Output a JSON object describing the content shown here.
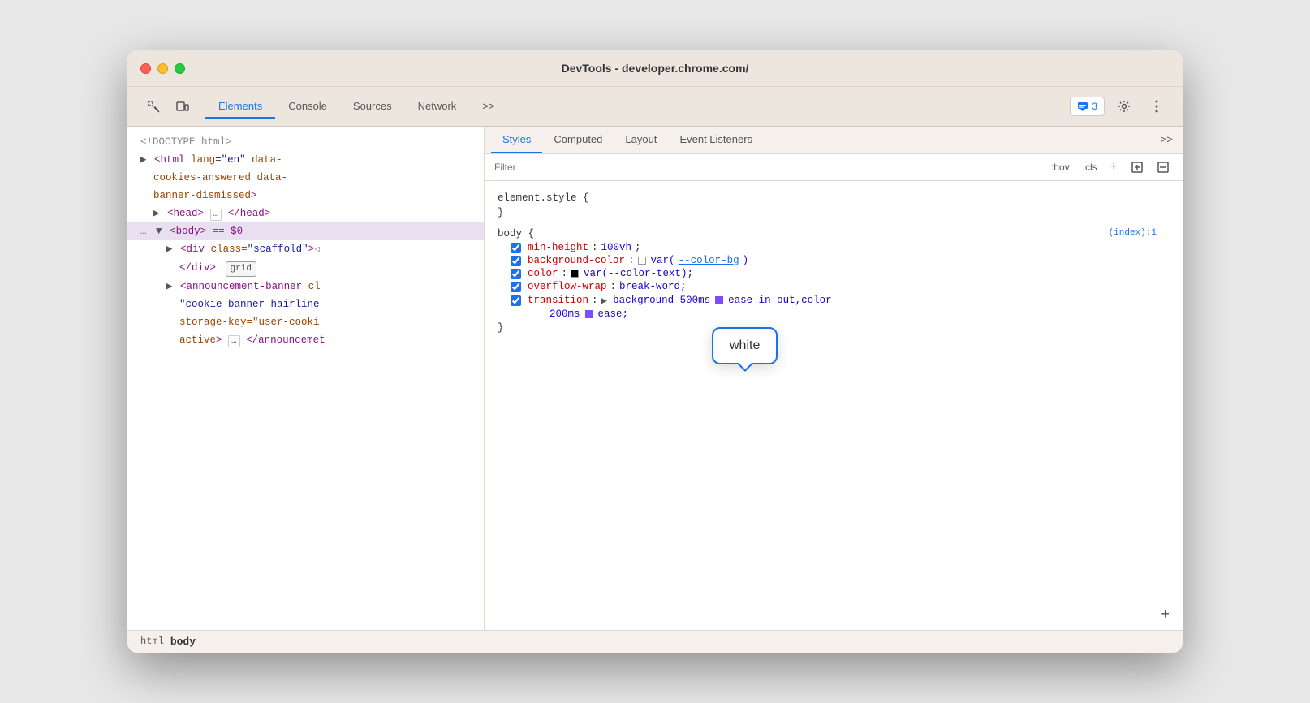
{
  "window": {
    "title": "DevTools - developer.chrome.com/"
  },
  "traffic_lights": {
    "red": "close",
    "yellow": "minimize",
    "green": "maximize"
  },
  "toolbar": {
    "tabs": [
      {
        "label": "Elements",
        "active": true
      },
      {
        "label": "Console",
        "active": false
      },
      {
        "label": "Sources",
        "active": false
      },
      {
        "label": "Network",
        "active": false
      },
      {
        "label": ">>",
        "active": false
      }
    ],
    "badge_label": "3",
    "more_label": ":"
  },
  "dom_panel": {
    "lines": [
      {
        "type": "comment",
        "text": "<!DOCTYPE html>",
        "indent": 0
      },
      {
        "type": "tag_open",
        "indent": 0
      },
      {
        "type": "body_selected",
        "indent": 0
      },
      {
        "type": "div_scaffold",
        "indent": 1
      },
      {
        "type": "div_close",
        "indent": 1
      },
      {
        "type": "announcement",
        "indent": 1
      },
      {
        "type": "announcement2",
        "indent": 1
      },
      {
        "type": "announcement3",
        "indent": 1
      }
    ]
  },
  "breadcrumb": {
    "items": [
      "html",
      "body"
    ]
  },
  "styles_panel": {
    "tabs": [
      {
        "label": "Styles",
        "active": true
      },
      {
        "label": "Computed",
        "active": false
      },
      {
        "label": "Layout",
        "active": false
      },
      {
        "label": "Event Listeners",
        "active": false
      },
      {
        "label": ">>",
        "active": false
      }
    ],
    "filter": {
      "placeholder": "Filter",
      "hov_label": ":hov",
      "cls_label": ".cls",
      "plus_label": "+"
    },
    "blocks": [
      {
        "selector": "element.style {",
        "close": "}",
        "rules": []
      },
      {
        "selector": "body {",
        "source": "(index):1",
        "close": "}",
        "rules": [
          {
            "prop": "min-height",
            "value": "100vh",
            "checked": true,
            "swatch": null
          },
          {
            "prop": "background-color",
            "value": "var(--color-bg)",
            "checked": true,
            "swatch": "white",
            "has_swatch": true
          },
          {
            "prop": "color",
            "value": "var(--color-text);",
            "checked": true,
            "swatch": "black",
            "has_swatch": true
          },
          {
            "prop": "overflow-wrap",
            "value": "break-word;",
            "checked": true,
            "swatch": null
          },
          {
            "prop": "transition",
            "value": "background 500ms ease-in-out,color 200ms ease;",
            "checked": true,
            "has_expand": true
          }
        ]
      }
    ],
    "tooltip": {
      "text": "white"
    },
    "plus_btn": "+"
  }
}
